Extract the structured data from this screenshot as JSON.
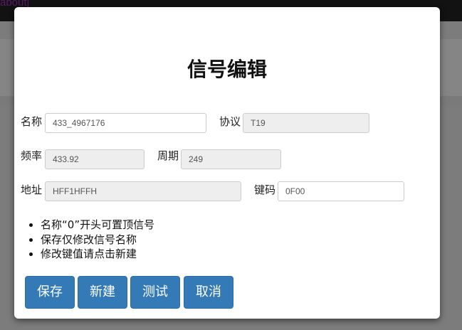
{
  "background": {
    "nav_link": "about|"
  },
  "dialog": {
    "title": "信号编辑",
    "fields": {
      "name": {
        "label": "名称",
        "value": "433_4967176"
      },
      "protocol": {
        "label": "协议",
        "value": "T19"
      },
      "frequency": {
        "label": "频率",
        "value": "433.92"
      },
      "period": {
        "label": "周期",
        "value": "249"
      },
      "address": {
        "label": "地址",
        "value": "HFF1HFFH"
      },
      "keycode": {
        "label": "键码",
        "value": "0F00"
      }
    },
    "notes": [
      "名称“0”开头可置顶信号",
      "保存仅修改信号名称",
      "修改键值请点击新建"
    ],
    "buttons": {
      "save": "保存",
      "new": "新建",
      "test": "测试",
      "cancel": "取消"
    }
  },
  "colors": {
    "primary": "#337ab7"
  }
}
